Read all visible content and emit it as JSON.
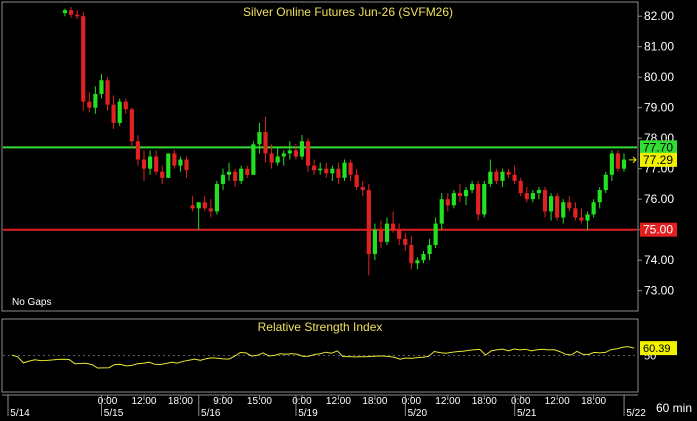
{
  "colors": {
    "background": "#000000",
    "panel_border": "#8c8c8c",
    "up_candle": "#22e022",
    "down_candle": "#e02222",
    "support_line": "#e02020",
    "resistance_line": "#33dd33",
    "rsi_line": "#e8e832",
    "title_text": "#f0e060",
    "axis_text": "#ffffff",
    "price_tag_bg": "#f0f000",
    "gridline": "#5a5a5a"
  },
  "chart_data": [
    {
      "type": "candlestick",
      "title": "Silver Online Futures Jun-26 (SVFM26)",
      "note": "No Gaps",
      "timeframe": "60 min",
      "ylim": [
        72.4,
        82.4
      ],
      "y_ticks": [
        73.0,
        74.0,
        75.0,
        76.0,
        77.0,
        78.0,
        79.0,
        80.0,
        81.0,
        82.0
      ],
      "x_tick_labels": [
        {
          "i": 7,
          "label": "0:00"
        },
        {
          "i": 13,
          "label": "12:00"
        },
        {
          "i": 19,
          "label": "18:00"
        },
        {
          "i": 26,
          "label": "9:00"
        },
        {
          "i": 32,
          "label": "15:00"
        },
        {
          "i": 39,
          "label": "0:00"
        },
        {
          "i": 45,
          "label": "12:00"
        },
        {
          "i": 51,
          "label": "18:00"
        },
        {
          "i": 57,
          "label": "0:00"
        },
        {
          "i": 63,
          "label": "12:00"
        },
        {
          "i": 69,
          "label": "18:00"
        },
        {
          "i": 75,
          "label": "0:00"
        },
        {
          "i": 81,
          "label": "12:00"
        },
        {
          "i": 87,
          "label": "18:00"
        }
      ],
      "date_labels": [
        {
          "i": 1,
          "label": "5/14"
        },
        {
          "i": 7,
          "label": "5/15"
        },
        {
          "i": 23,
          "label": "5/16"
        },
        {
          "i": 39,
          "label": "5/19"
        },
        {
          "i": 57,
          "label": "5/20"
        },
        {
          "i": 75,
          "label": "5/21"
        },
        {
          "i": 93,
          "label": "5/22"
        }
      ],
      "horizontal_lines": [
        {
          "name": "resistance",
          "value": 77.7,
          "label": "77.70"
        },
        {
          "name": "support",
          "value": 75.0,
          "label": "75.00"
        }
      ],
      "last_price": {
        "value": 77.29,
        "label": "77.29"
      },
      "ohlc": [
        [
          82.1,
          82.25,
          82.0,
          82.2
        ],
        [
          82.2,
          82.3,
          81.95,
          82.05
        ],
        [
          82.05,
          82.2,
          81.9,
          82.0
        ],
        [
          82.0,
          82.15,
          78.9,
          79.2
        ],
        [
          79.2,
          79.5,
          78.85,
          79.0
        ],
        [
          79.0,
          79.7,
          78.8,
          79.45
        ],
        [
          79.45,
          80.1,
          79.3,
          79.9
        ],
        [
          79.9,
          80.0,
          78.9,
          79.1
        ],
        [
          79.1,
          79.4,
          78.3,
          78.5
        ],
        [
          78.5,
          79.3,
          78.4,
          79.2
        ],
        [
          79.2,
          79.3,
          78.8,
          78.95
        ],
        [
          78.95,
          79.0,
          77.7,
          77.9
        ],
        [
          77.9,
          78.1,
          77.1,
          77.3
        ],
        [
          77.3,
          77.6,
          76.6,
          77.0
        ],
        [
          77.0,
          77.6,
          76.8,
          77.4
        ],
        [
          77.4,
          77.6,
          76.8,
          76.9
        ],
        [
          76.9,
          77.1,
          76.5,
          76.7
        ],
        [
          76.7,
          77.5,
          76.7,
          77.5
        ],
        [
          77.5,
          77.6,
          77.0,
          77.1
        ],
        [
          77.1,
          77.4,
          76.9,
          77.3
        ],
        [
          77.3,
          77.4,
          76.7,
          76.95
        ],
        [
          75.8,
          76.1,
          75.6,
          75.7
        ],
        [
          75.7,
          75.9,
          75.0,
          75.9
        ],
        [
          75.9,
          76.1,
          75.6,
          75.7
        ],
        [
          75.7,
          76.0,
          75.4,
          75.6
        ],
        [
          75.6,
          76.6,
          75.5,
          76.5
        ],
        [
          76.5,
          77.0,
          76.3,
          76.8
        ],
        [
          76.8,
          77.2,
          76.6,
          76.9
        ],
        [
          76.9,
          77.0,
          76.4,
          76.6
        ],
        [
          76.6,
          77.1,
          76.5,
          77.0
        ],
        [
          77.0,
          77.1,
          76.7,
          76.8
        ],
        [
          76.8,
          77.9,
          76.8,
          77.8
        ],
        [
          77.8,
          78.5,
          77.5,
          78.2
        ],
        [
          78.2,
          78.7,
          77.2,
          77.5
        ],
        [
          77.5,
          77.8,
          77.0,
          77.2
        ],
        [
          77.2,
          77.7,
          77.1,
          77.4
        ],
        [
          77.4,
          77.6,
          77.1,
          77.5
        ],
        [
          77.5,
          77.9,
          77.3,
          77.6
        ],
        [
          77.6,
          77.8,
          77.3,
          77.4
        ],
        [
          77.4,
          78.1,
          77.3,
          77.9
        ],
        [
          77.9,
          78.0,
          76.9,
          77.1
        ],
        [
          77.1,
          77.3,
          76.8,
          76.95
        ],
        [
          76.95,
          77.2,
          76.8,
          77.0
        ],
        [
          77.0,
          77.2,
          76.7,
          76.85
        ],
        [
          76.85,
          77.1,
          76.6,
          77.0
        ],
        [
          77.0,
          77.2,
          76.5,
          76.7
        ],
        [
          76.7,
          77.3,
          76.6,
          77.2
        ],
        [
          77.2,
          77.3,
          76.6,
          76.8
        ],
        [
          76.8,
          77.0,
          76.3,
          76.4
        ],
        [
          76.4,
          76.6,
          76.1,
          76.3
        ],
        [
          76.3,
          76.5,
          73.5,
          74.2
        ],
        [
          74.2,
          75.2,
          74.0,
          75.0
        ],
        [
          75.0,
          75.3,
          74.4,
          74.6
        ],
        [
          74.6,
          75.4,
          74.5,
          75.2
        ],
        [
          75.2,
          75.6,
          74.9,
          75.0
        ],
        [
          75.0,
          75.2,
          74.5,
          74.7
        ],
        [
          74.7,
          74.9,
          74.3,
          74.5
        ],
        [
          74.5,
          74.8,
          73.7,
          73.9
        ],
        [
          73.9,
          74.1,
          73.7,
          74.0
        ],
        [
          74.0,
          74.3,
          73.9,
          74.2
        ],
        [
          74.2,
          74.7,
          74.0,
          74.5
        ],
        [
          74.5,
          75.4,
          74.4,
          75.2
        ],
        [
          75.2,
          76.2,
          75.0,
          76.0
        ],
        [
          76.0,
          76.2,
          75.6,
          75.8
        ],
        [
          75.8,
          76.3,
          75.7,
          76.2
        ],
        [
          76.2,
          76.5,
          75.9,
          76.1
        ],
        [
          76.1,
          76.4,
          75.8,
          76.3
        ],
        [
          76.3,
          76.6,
          76.2,
          76.5
        ],
        [
          76.5,
          76.6,
          75.3,
          75.5
        ],
        [
          75.5,
          76.6,
          75.4,
          76.5
        ],
        [
          76.5,
          77.3,
          76.4,
          76.9
        ],
        [
          76.9,
          77.0,
          76.5,
          76.6
        ],
        [
          76.6,
          77.0,
          76.4,
          76.9
        ],
        [
          76.9,
          77.0,
          76.7,
          76.8
        ],
        [
          76.8,
          77.1,
          76.5,
          76.6
        ],
        [
          76.6,
          76.7,
          76.1,
          76.2
        ],
        [
          76.2,
          76.4,
          75.9,
          76.0
        ],
        [
          76.0,
          76.3,
          75.9,
          76.2
        ],
        [
          76.2,
          76.4,
          76.0,
          76.3
        ],
        [
          76.3,
          76.4,
          75.4,
          75.6
        ],
        [
          75.6,
          76.2,
          75.3,
          76.1
        ],
        [
          76.1,
          76.2,
          75.3,
          75.4
        ],
        [
          75.4,
          76.0,
          75.2,
          75.9
        ],
        [
          75.9,
          76.1,
          75.6,
          75.7
        ],
        [
          75.7,
          75.9,
          75.3,
          75.4
        ],
        [
          75.4,
          75.7,
          75.2,
          75.3
        ],
        [
          75.3,
          75.6,
          75.0,
          75.5
        ],
        [
          75.5,
          76.0,
          75.4,
          75.9
        ],
        [
          75.9,
          76.4,
          75.7,
          76.3
        ],
        [
          76.3,
          76.9,
          76.2,
          76.8
        ],
        [
          76.8,
          77.6,
          76.6,
          77.5
        ],
        [
          77.5,
          77.6,
          76.9,
          77.0
        ],
        [
          77.0,
          77.5,
          76.9,
          77.3
        ]
      ]
    },
    {
      "type": "line",
      "title": "Relative Strength Index",
      "ylim": [
        0,
        100
      ],
      "y_tick": {
        "value": 50,
        "label": "50"
      },
      "last_value": {
        "value": 60.39,
        "label": "60.39"
      },
      "series": [
        {
          "values": [
            50.5,
            48.1,
            39.6,
            42.1,
            44.0,
            42.8,
            43.0,
            43.7,
            44.5,
            44.8,
            44.3,
            38.4,
            38.8,
            39.0,
            37.2,
            32.4,
            32.5,
            32.8,
            37.3,
            37.5,
            35.3,
            36.1,
            38.4,
            39.1,
            40.6,
            37.7,
            37.3,
            38.8,
            40.5,
            39.3,
            41.8,
            43.2,
            45.0,
            43.3,
            45.4,
            46.7,
            46.1,
            45.2,
            45.0,
            49.0,
            54.2,
            53.7,
            49.2,
            50.3,
            53.6,
            49.3,
            50.1,
            52.4,
            51.7,
            52.7,
            51.7,
            48.8,
            48.9,
            51.4,
            52.5,
            54.7,
            53.2,
            56.5,
            48.5,
            48.4,
            48.0,
            48.2,
            48.2,
            48.7,
            49.2,
            49.3,
            48.6,
            47.5,
            44.8,
            46.5,
            45.9,
            47.1,
            47.6,
            48.9,
            55.6,
            54.1,
            53.1,
            54.4,
            55.5,
            56.1,
            57.2,
            58.1,
            58.6,
            50.5,
            56.5,
            58.0,
            59.0,
            56.5,
            59.1,
            57.9,
            58.9,
            56.5,
            58.2,
            58.9,
            57.9,
            58.3,
            55.5,
            51.8,
            50.7,
            55.9,
            51.8,
            51.4,
            54.4,
            53.6,
            54.4,
            58.3,
            59.6,
            61.6,
            62.6,
            60.4
          ]
        }
      ]
    }
  ]
}
